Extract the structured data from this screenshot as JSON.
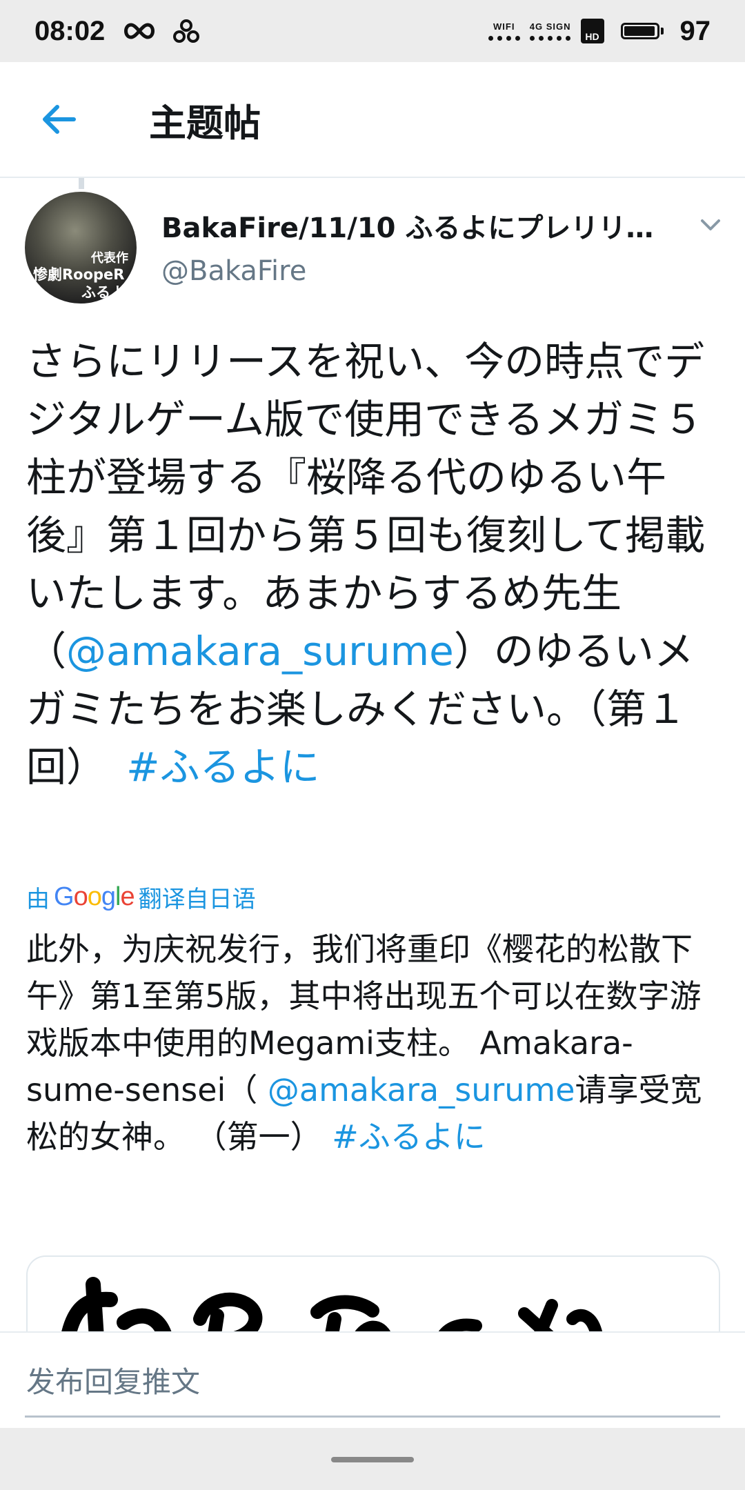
{
  "status_bar": {
    "time": "08:02",
    "wifi_label": "WIFI",
    "network_label": "4G SIGN",
    "hd_label": "HD",
    "battery_percent": "97",
    "battery_level": 0.97
  },
  "header": {
    "title": "主题帖"
  },
  "tweet": {
    "display_name": "BakaFire/11/10 ふるよにプレリリ…",
    "username": "@BakaFire",
    "avatar_text": [
      "代表作",
      "惨劇RoopeR",
      "ふるよ"
    ],
    "body": {
      "text_1": "さらにリリースを祝い、今の時点でデジタルゲーム版で使用できるメガミ５柱が登場する『桜降る代のゆるい午後』第１回から第５回も復刻して掲載いたします。あまからするめ先生（",
      "mention": "@amakara_surume",
      "text_2": "）のゆるいメガミたちをお楽しみください。（第１回）　",
      "hashtag": "#ふるよに"
    },
    "translate": {
      "prefix": "由",
      "brand": "Google",
      "suffix": "翻译自日语"
    },
    "translation": {
      "text_1": "此外，为庆祝发行，我们将重印《樱花的松散下午》第1至第5版，其中将出现五个可以在数字游戏版本中使用的Megami支柱。 Amakara-sume-sensei（ ",
      "mention": "@amakara_surume",
      "text_2": "请享受宽松的女神。 （第一） ",
      "hashtag": "#ふるよに"
    }
  },
  "reply_bar": {
    "placeholder": "发布回复推文"
  },
  "colors": {
    "link": "#1b95e0",
    "text": "#14171a",
    "secondary": "#657786"
  }
}
